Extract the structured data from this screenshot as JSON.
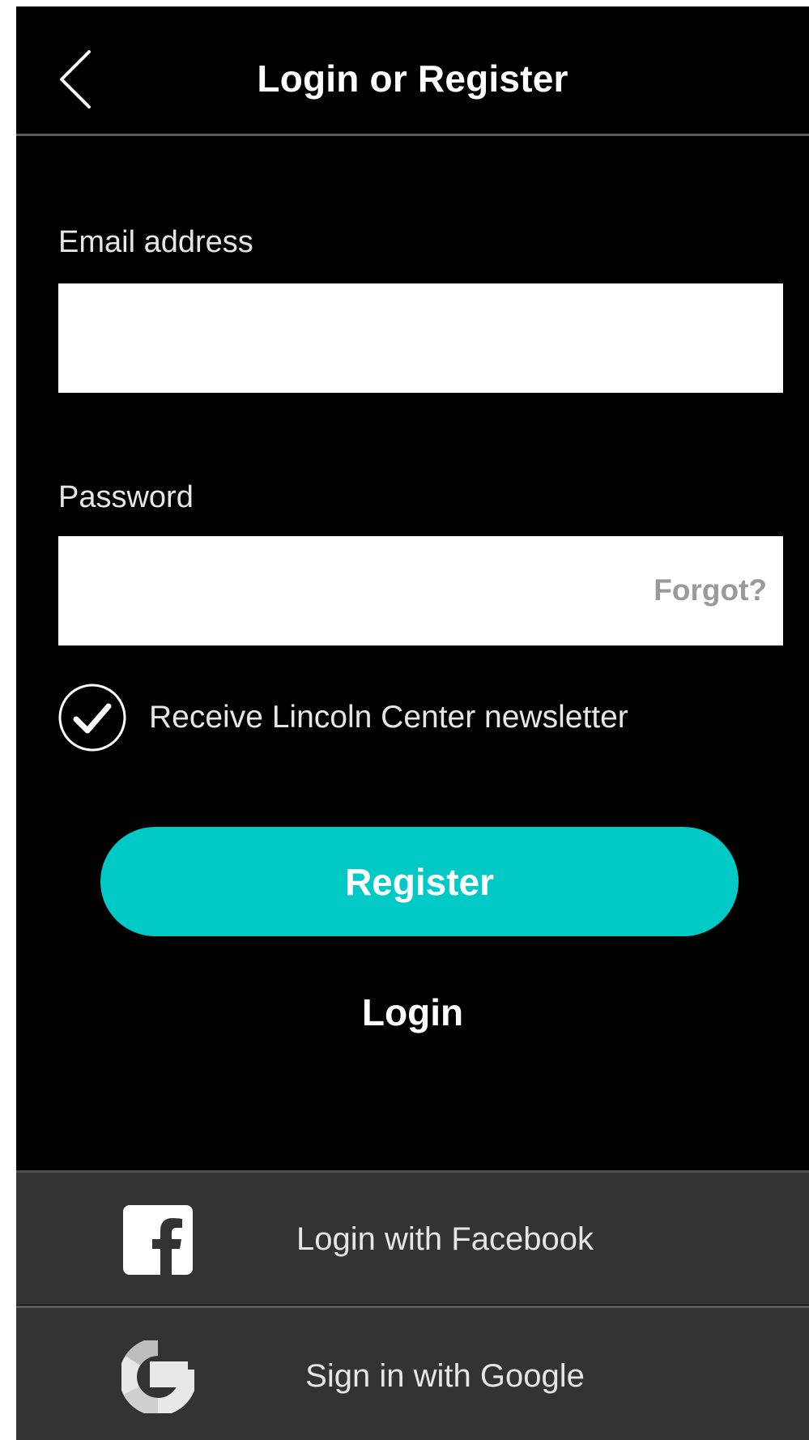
{
  "header": {
    "title": "Login or Register"
  },
  "form": {
    "email_label": "Email address",
    "email_value": "",
    "password_label": "Password",
    "password_value": "",
    "forgot_label": "Forgot?",
    "newsletter_label": "Receive Lincoln Center newsletter",
    "newsletter_checked": true
  },
  "actions": {
    "register_label": "Register",
    "login_label": "Login"
  },
  "social": {
    "facebook_label": "Login with Facebook",
    "google_label": "Sign in with Google"
  },
  "colors": {
    "accent": "#00c9c6",
    "background": "#000000",
    "social_bar": "#333333"
  }
}
